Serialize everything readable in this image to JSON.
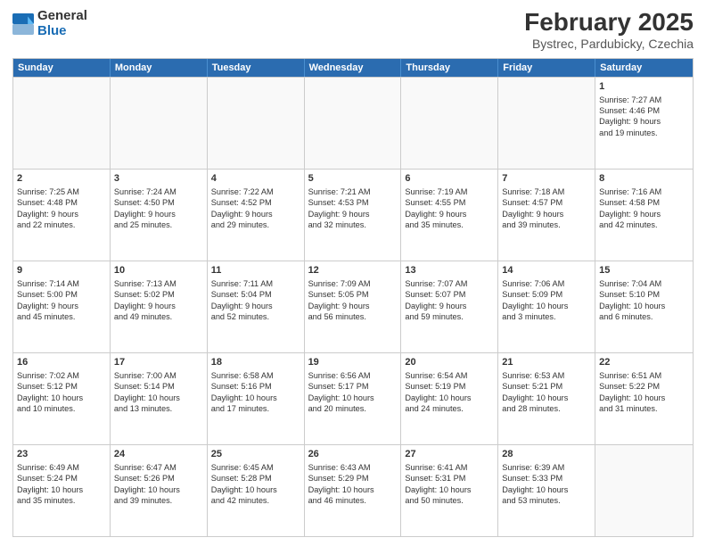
{
  "header": {
    "logo": {
      "line1": "General",
      "line2": "Blue"
    },
    "title": "February 2025",
    "subtitle": "Bystrec, Pardubicky, Czechia"
  },
  "days": [
    "Sunday",
    "Monday",
    "Tuesday",
    "Wednesday",
    "Thursday",
    "Friday",
    "Saturday"
  ],
  "weeks": [
    [
      {
        "day": "",
        "info": ""
      },
      {
        "day": "",
        "info": ""
      },
      {
        "day": "",
        "info": ""
      },
      {
        "day": "",
        "info": ""
      },
      {
        "day": "",
        "info": ""
      },
      {
        "day": "",
        "info": ""
      },
      {
        "day": "1",
        "info": "Sunrise: 7:27 AM\nSunset: 4:46 PM\nDaylight: 9 hours\nand 19 minutes."
      }
    ],
    [
      {
        "day": "2",
        "info": "Sunrise: 7:25 AM\nSunset: 4:48 PM\nDaylight: 9 hours\nand 22 minutes."
      },
      {
        "day": "3",
        "info": "Sunrise: 7:24 AM\nSunset: 4:50 PM\nDaylight: 9 hours\nand 25 minutes."
      },
      {
        "day": "4",
        "info": "Sunrise: 7:22 AM\nSunset: 4:52 PM\nDaylight: 9 hours\nand 29 minutes."
      },
      {
        "day": "5",
        "info": "Sunrise: 7:21 AM\nSunset: 4:53 PM\nDaylight: 9 hours\nand 32 minutes."
      },
      {
        "day": "6",
        "info": "Sunrise: 7:19 AM\nSunset: 4:55 PM\nDaylight: 9 hours\nand 35 minutes."
      },
      {
        "day": "7",
        "info": "Sunrise: 7:18 AM\nSunset: 4:57 PM\nDaylight: 9 hours\nand 39 minutes."
      },
      {
        "day": "8",
        "info": "Sunrise: 7:16 AM\nSunset: 4:58 PM\nDaylight: 9 hours\nand 42 minutes."
      }
    ],
    [
      {
        "day": "9",
        "info": "Sunrise: 7:14 AM\nSunset: 5:00 PM\nDaylight: 9 hours\nand 45 minutes."
      },
      {
        "day": "10",
        "info": "Sunrise: 7:13 AM\nSunset: 5:02 PM\nDaylight: 9 hours\nand 49 minutes."
      },
      {
        "day": "11",
        "info": "Sunrise: 7:11 AM\nSunset: 5:04 PM\nDaylight: 9 hours\nand 52 minutes."
      },
      {
        "day": "12",
        "info": "Sunrise: 7:09 AM\nSunset: 5:05 PM\nDaylight: 9 hours\nand 56 minutes."
      },
      {
        "day": "13",
        "info": "Sunrise: 7:07 AM\nSunset: 5:07 PM\nDaylight: 9 hours\nand 59 minutes."
      },
      {
        "day": "14",
        "info": "Sunrise: 7:06 AM\nSunset: 5:09 PM\nDaylight: 10 hours\nand 3 minutes."
      },
      {
        "day": "15",
        "info": "Sunrise: 7:04 AM\nSunset: 5:10 PM\nDaylight: 10 hours\nand 6 minutes."
      }
    ],
    [
      {
        "day": "16",
        "info": "Sunrise: 7:02 AM\nSunset: 5:12 PM\nDaylight: 10 hours\nand 10 minutes."
      },
      {
        "day": "17",
        "info": "Sunrise: 7:00 AM\nSunset: 5:14 PM\nDaylight: 10 hours\nand 13 minutes."
      },
      {
        "day": "18",
        "info": "Sunrise: 6:58 AM\nSunset: 5:16 PM\nDaylight: 10 hours\nand 17 minutes."
      },
      {
        "day": "19",
        "info": "Sunrise: 6:56 AM\nSunset: 5:17 PM\nDaylight: 10 hours\nand 20 minutes."
      },
      {
        "day": "20",
        "info": "Sunrise: 6:54 AM\nSunset: 5:19 PM\nDaylight: 10 hours\nand 24 minutes."
      },
      {
        "day": "21",
        "info": "Sunrise: 6:53 AM\nSunset: 5:21 PM\nDaylight: 10 hours\nand 28 minutes."
      },
      {
        "day": "22",
        "info": "Sunrise: 6:51 AM\nSunset: 5:22 PM\nDaylight: 10 hours\nand 31 minutes."
      }
    ],
    [
      {
        "day": "23",
        "info": "Sunrise: 6:49 AM\nSunset: 5:24 PM\nDaylight: 10 hours\nand 35 minutes."
      },
      {
        "day": "24",
        "info": "Sunrise: 6:47 AM\nSunset: 5:26 PM\nDaylight: 10 hours\nand 39 minutes."
      },
      {
        "day": "25",
        "info": "Sunrise: 6:45 AM\nSunset: 5:28 PM\nDaylight: 10 hours\nand 42 minutes."
      },
      {
        "day": "26",
        "info": "Sunrise: 6:43 AM\nSunset: 5:29 PM\nDaylight: 10 hours\nand 46 minutes."
      },
      {
        "day": "27",
        "info": "Sunrise: 6:41 AM\nSunset: 5:31 PM\nDaylight: 10 hours\nand 50 minutes."
      },
      {
        "day": "28",
        "info": "Sunrise: 6:39 AM\nSunset: 5:33 PM\nDaylight: 10 hours\nand 53 minutes."
      },
      {
        "day": "",
        "info": ""
      }
    ]
  ]
}
